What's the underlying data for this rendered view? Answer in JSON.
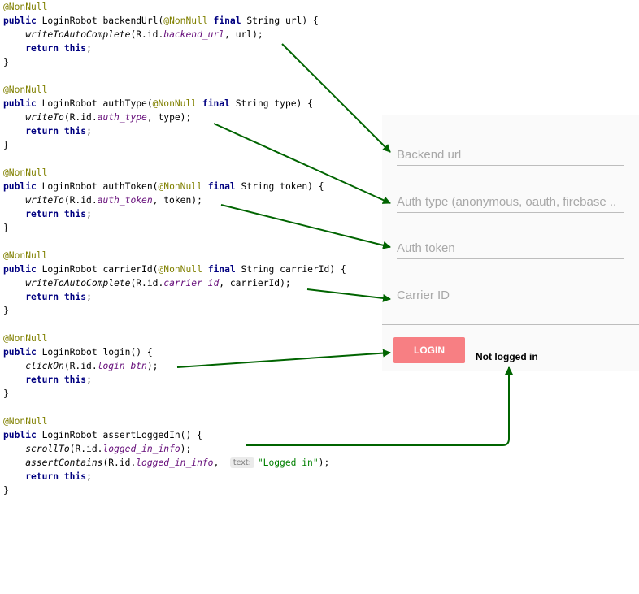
{
  "code": {
    "blocks": [
      {
        "annotation": "@NonNull",
        "sig_public": "public",
        "sig_type": "LoginRobot",
        "sig_name": "backendUrl(",
        "param_anno": "@NonNull",
        "param_final": "final",
        "param_rest": "String url) {",
        "call": "writeToAutoComplete",
        "call_open": "(R.id.",
        "field": "backend_url",
        "call_rest": ", url);",
        "ret_kw": "return",
        "ret_this": "this",
        "ret_end": ";",
        "close": "}"
      },
      {
        "annotation": "@NonNull",
        "sig_public": "public",
        "sig_type": "LoginRobot",
        "sig_name": "authType(",
        "param_anno": "@NonNull",
        "param_final": "final",
        "param_rest": "String type) {",
        "call": "writeTo",
        "call_open": "(R.id.",
        "field": "auth_type",
        "call_rest": ", type);",
        "ret_kw": "return",
        "ret_this": "this",
        "ret_end": ";",
        "close": "}"
      },
      {
        "annotation": "@NonNull",
        "sig_public": "public",
        "sig_type": "LoginRobot",
        "sig_name": "authToken(",
        "param_anno": "@NonNull",
        "param_final": "final",
        "param_rest": "String token) {",
        "call": "writeTo",
        "call_open": "(R.id.",
        "field": "auth_token",
        "call_rest": ", token);",
        "ret_kw": "return",
        "ret_this": "this",
        "ret_end": ";",
        "close": "}"
      },
      {
        "annotation": "@NonNull",
        "sig_public": "public",
        "sig_type": "LoginRobot",
        "sig_name": "carrierId(",
        "param_anno": "@NonNull",
        "param_final": "final",
        "param_rest": "String carrierId) {",
        "call": "writeToAutoComplete",
        "call_open": "(R.id.",
        "field": "carrier_id",
        "call_rest": ", carrierId);",
        "ret_kw": "return",
        "ret_this": "this",
        "ret_end": ";",
        "close": "}"
      },
      {
        "annotation": "@NonNull",
        "sig_public": "public",
        "sig_type": "LoginRobot",
        "sig_name": "login() {",
        "call": "clickOn",
        "call_open": "(R.id.",
        "field": "login_btn",
        "call_rest": ");",
        "ret_kw": "return",
        "ret_this": "this",
        "ret_end": ";",
        "close": "}"
      },
      {
        "annotation": "@NonNull",
        "sig_public": "public",
        "sig_type": "LoginRobot",
        "sig_name": "assertLoggedIn() {",
        "call": "scrollTo",
        "call_open": "(R.id.",
        "field": "logged_in_info",
        "call_rest": ");",
        "call2": "assertContains",
        "call2_open": "(R.id.",
        "field2": "logged_in_info",
        "call2_comma": ",",
        "hint": "text:",
        "str": "\"Logged in\"",
        "call2_end": ");",
        "ret_kw": "return",
        "ret_this": "this",
        "ret_end": ";",
        "close": "}"
      }
    ]
  },
  "form": {
    "backend_url_placeholder": "Backend url",
    "auth_type_placeholder": "Auth type (anonymous, oauth, firebase ..",
    "auth_token_placeholder": "Auth token",
    "carrier_id_placeholder": "Carrier ID",
    "login_label": "LOGIN",
    "status_text": "Not logged in"
  },
  "colors": {
    "annotation": "#808000",
    "keyword": "#000080",
    "field": "#660e7a",
    "string": "#008000",
    "login_button": "#f77f83",
    "arrow": "#006400"
  }
}
